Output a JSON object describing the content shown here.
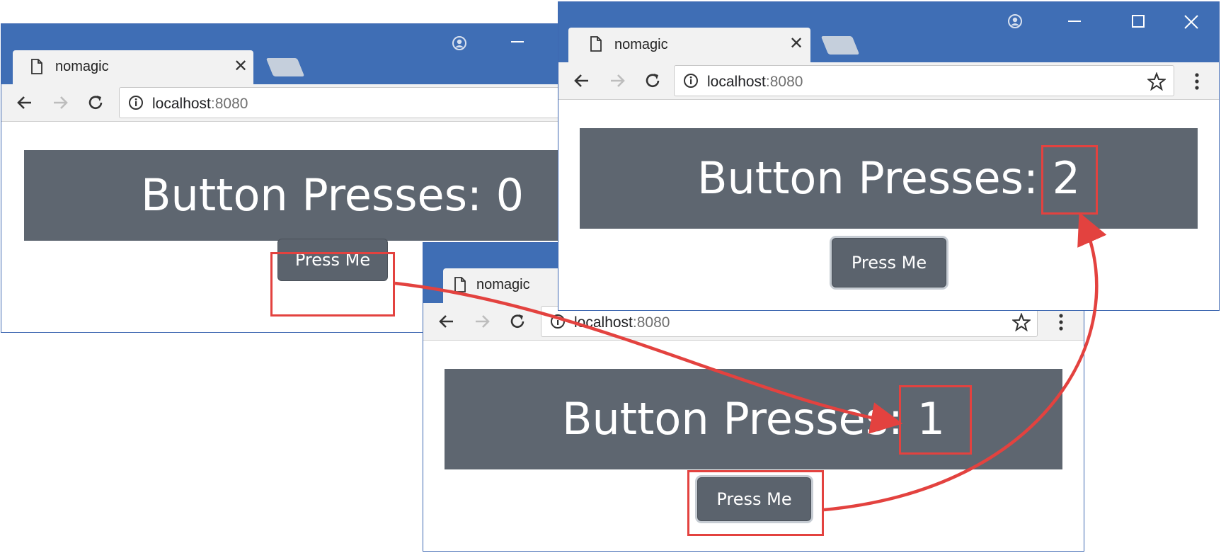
{
  "windows": [
    {
      "tab_title": "nomagic",
      "url_host": "localhost",
      "url_port": ":8080",
      "banner_label": "Button Presses: ",
      "count": "0",
      "button_label": "Press Me"
    },
    {
      "tab_title": "nomagic",
      "url_host": "localhost",
      "url_port": ":8080",
      "banner_label": "Button Presses: ",
      "count": "1",
      "button_label": "Press Me"
    },
    {
      "tab_title": "nomagic",
      "url_host": "localhost",
      "url_port": ":8080",
      "banner_label": "Button Presses: ",
      "count": "2",
      "button_label": "Press Me"
    }
  ],
  "colors": {
    "titlebar": "#3f6eb5",
    "banner": "#5e6670",
    "button": "#5b636d",
    "highlight": "#e3423f"
  },
  "icons": [
    "page-icon",
    "close-icon",
    "back-icon",
    "forward-icon",
    "reload-icon",
    "info-icon",
    "star-icon",
    "menu-icon",
    "profile-icon",
    "minimize-icon",
    "maximize-icon",
    "window-close-icon"
  ]
}
